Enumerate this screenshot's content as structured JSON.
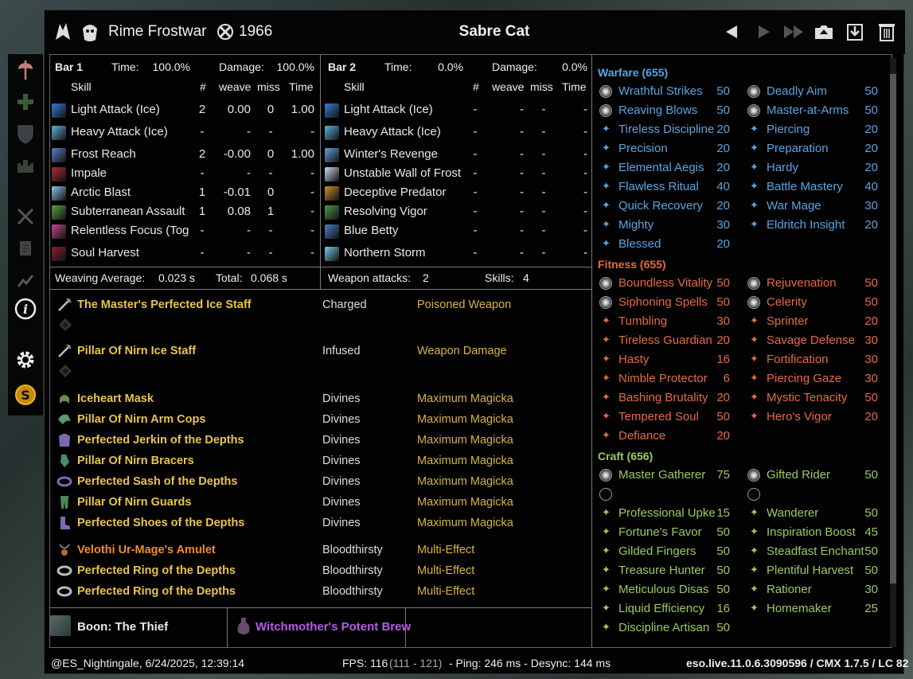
{
  "window": {
    "player_name": "Rime Frostwar",
    "champion_points": "1966",
    "title": "Sabre Cat"
  },
  "sidebar": {
    "icons": [
      "axe-icon",
      "heal-cross-icon",
      "shield-icon",
      "castle-icon",
      "crossed-swords-icon",
      "scroll-icon",
      "chart-icon",
      "info-icon",
      "gear-icon",
      "s-coin-icon"
    ]
  },
  "bar1": {
    "label": "Bar 1",
    "time_label": "Time:",
    "time": "100.0%",
    "damage_label": "Damage:",
    "damage": "100.0%",
    "col_skill": "Skill",
    "col_count": "#",
    "col_weave": "weave",
    "col_miss": "miss",
    "col_time": "Time",
    "rows": [
      {
        "skill": "Light Attack (Ice)",
        "count": "2",
        "weave": "0.00",
        "miss": "0",
        "time": "1.00",
        "color": "#3a7bd5"
      },
      {
        "skill": "Heavy Attack (Ice)",
        "count": "-",
        "weave": "-",
        "miss": "-",
        "time": "-",
        "color": "#5fb0e0"
      },
      {
        "skill": "Frost Reach",
        "count": "2",
        "weave": "-0.00",
        "miss": "0",
        "time": "1.00",
        "color": "#5b7fc4"
      },
      {
        "skill": "Impale",
        "count": "-",
        "weave": "-",
        "miss": "-",
        "time": "-",
        "color": "#b02a3a"
      },
      {
        "skill": "Arctic Blast",
        "count": "1",
        "weave": "-0.01",
        "miss": "0",
        "time": "-",
        "color": "#8fc0ea"
      },
      {
        "skill": "Subterranean Assault",
        "count": "1",
        "weave": "0.08",
        "miss": "1",
        "time": "-",
        "color": "#5aa040"
      },
      {
        "skill": "Relentless Focus (Tog",
        "count": "-",
        "weave": "-",
        "miss": "-",
        "time": "-",
        "color": "#c04a8a"
      },
      {
        "skill": "Soul Harvest",
        "count": "-",
        "weave": "-",
        "miss": "-",
        "time": "-",
        "color": "#8a2030"
      }
    ]
  },
  "bar2": {
    "label": "Bar 2",
    "time_label": "Time:",
    "time": "0.0%",
    "damage_label": "Damage:",
    "damage": "0.0%",
    "col_skill": "Skill",
    "col_count": "#",
    "col_weave": "weave",
    "col_miss": "miss",
    "col_time": "Time",
    "rows": [
      {
        "skill": "Light Attack (Ice)",
        "count": "-",
        "weave": "-",
        "miss": "-",
        "time": "-",
        "color": "#3a7bd5"
      },
      {
        "skill": "Heavy Attack (Ice)",
        "count": "-",
        "weave": "-",
        "miss": "-",
        "time": "-",
        "color": "#5fb0e0"
      },
      {
        "skill": "Winter's Revenge",
        "count": "-",
        "weave": "-",
        "miss": "-",
        "time": "-",
        "color": "#6aa0d8"
      },
      {
        "skill": "Unstable Wall of Frost",
        "count": "-",
        "weave": "-",
        "miss": "-",
        "time": "-",
        "color": "#c8d8f0"
      },
      {
        "skill": "Deceptive Predator",
        "count": "-",
        "weave": "-",
        "miss": "-",
        "time": "-",
        "color": "#c89030"
      },
      {
        "skill": "Resolving Vigor",
        "count": "-",
        "weave": "-",
        "miss": "-",
        "time": "-",
        "color": "#4a9a50"
      },
      {
        "skill": "Blue Betty",
        "count": "-",
        "weave": "-",
        "miss": "-",
        "time": "-",
        "color": "#4a80c0"
      },
      {
        "skill": "Northern Storm",
        "count": "-",
        "weave": "-",
        "miss": "-",
        "time": "-",
        "color": "#80c8e8"
      }
    ]
  },
  "stats": {
    "weaving_avg_label": "Weaving Average:",
    "weaving_avg": "0.023 s",
    "total_label": "Total:",
    "total": "0.068 s",
    "weapon_attacks_label": "Weapon attacks:",
    "weapon_attacks": "2",
    "skills_label": "Skills:",
    "skills": "4"
  },
  "equipment": [
    {
      "name": "The Master's Perfected Ice Staff",
      "trait": "Charged",
      "enchant": "Poisoned Weapon",
      "quality": "gold",
      "icon": "staff-icon"
    },
    {
      "name": "Pillar Of Nirn Ice Staff",
      "trait": "Infused",
      "enchant": "Weapon Damage",
      "quality": "gold",
      "icon": "staff-icon"
    },
    {
      "name": "Iceheart Mask",
      "trait": "Divines",
      "enchant": "Maximum Magicka",
      "quality": "gold",
      "icon": "helmet-icon"
    },
    {
      "name": "Pillar Of Nirn Arm Cops",
      "trait": "Divines",
      "enchant": "Maximum Magicka",
      "quality": "gold",
      "icon": "shoulder-icon"
    },
    {
      "name": "Perfected Jerkin of the Depths",
      "trait": "Divines",
      "enchant": "Maximum Magicka",
      "quality": "gold",
      "icon": "chest-icon"
    },
    {
      "name": "Pillar Of Nirn Bracers",
      "trait": "Divines",
      "enchant": "Maximum Magicka",
      "quality": "gold",
      "icon": "gloves-icon"
    },
    {
      "name": "Perfected Sash of the Depths",
      "trait": "Divines",
      "enchant": "Maximum Magicka",
      "quality": "gold",
      "icon": "belt-icon"
    },
    {
      "name": "Pillar Of Nirn Guards",
      "trait": "Divines",
      "enchant": "Maximum Magicka",
      "quality": "gold",
      "icon": "legs-icon"
    },
    {
      "name": "Perfected Shoes of the Depths",
      "trait": "Divines",
      "enchant": "Maximum Magicka",
      "quality": "gold",
      "icon": "boots-icon"
    },
    {
      "name": "Velothi Ur-Mage's Amulet",
      "trait": "Bloodthirsty",
      "enchant": "Multi-Effect",
      "quality": "orange",
      "icon": "amulet-icon"
    },
    {
      "name": "Perfected Ring of the Depths",
      "trait": "Bloodthirsty",
      "enchant": "Multi-Effect",
      "quality": "gold",
      "icon": "ring-icon"
    },
    {
      "name": "Perfected Ring of the Depths",
      "trait": "Bloodthirsty",
      "enchant": "Multi-Effect",
      "quality": "gold",
      "icon": "ring-icon"
    }
  ],
  "boon": "Boon: The Thief",
  "food": "Witchmother's Potent Brew",
  "cp": {
    "warfare": {
      "title": "Warfare (655)",
      "left": [
        {
          "name": "Wrathful Strikes",
          "val": "50",
          "slotted": true
        },
        {
          "name": "Reaving Blows",
          "val": "50",
          "slotted": true
        },
        {
          "name": "Tireless Discipline",
          "val": "20"
        },
        {
          "name": "Precision",
          "val": "20"
        },
        {
          "name": "Elemental Aegis",
          "val": "20"
        },
        {
          "name": "Flawless Ritual",
          "val": "40"
        },
        {
          "name": "Quick Recovery",
          "val": "20"
        },
        {
          "name": "Mighty",
          "val": "30"
        },
        {
          "name": "Blessed",
          "val": "20"
        }
      ],
      "right": [
        {
          "name": "Deadly Aim",
          "val": "50",
          "slotted": true
        },
        {
          "name": "Master-at-Arms",
          "val": "50",
          "slotted": true
        },
        {
          "name": "Piercing",
          "val": "20"
        },
        {
          "name": "Preparation",
          "val": "20"
        },
        {
          "name": "Hardy",
          "val": "20"
        },
        {
          "name": "Battle Mastery",
          "val": "40"
        },
        {
          "name": "War Mage",
          "val": "30"
        },
        {
          "name": "Eldritch Insight",
          "val": "20"
        }
      ]
    },
    "fitness": {
      "title": "Fitness (655)",
      "left": [
        {
          "name": "Boundless Vitality",
          "val": "50",
          "slotted": true
        },
        {
          "name": "Siphoning Spells",
          "val": "50",
          "slotted": true
        },
        {
          "name": "Tumbling",
          "val": "30"
        },
        {
          "name": "Tireless Guardian",
          "val": "20"
        },
        {
          "name": "Hasty",
          "val": "16"
        },
        {
          "name": "Nimble Protector",
          "val": "6"
        },
        {
          "name": "Bashing Brutality",
          "val": "20"
        },
        {
          "name": "Tempered Soul",
          "val": "50"
        },
        {
          "name": "Defiance",
          "val": "20"
        }
      ],
      "right": [
        {
          "name": "Rejuvenation",
          "val": "50",
          "slotted": true
        },
        {
          "name": "Celerity",
          "val": "50",
          "slotted": true
        },
        {
          "name": "Sprinter",
          "val": "20"
        },
        {
          "name": "Savage Defense",
          "val": "30"
        },
        {
          "name": "Fortification",
          "val": "30"
        },
        {
          "name": "Piercing Gaze",
          "val": "30"
        },
        {
          "name": "Mystic Tenacity",
          "val": "50"
        },
        {
          "name": "Hero's Vigor",
          "val": "20"
        }
      ]
    },
    "craft": {
      "title": "Craft (656)",
      "left": [
        {
          "name": "Master Gatherer",
          "val": "75",
          "slotted": true
        },
        {
          "name": "",
          "val": "",
          "slotted": true,
          "empty": true
        },
        {
          "name": "Professional Upke",
          "val": "15"
        },
        {
          "name": "Fortune's Favor",
          "val": "50"
        },
        {
          "name": "Gilded Fingers",
          "val": "50"
        },
        {
          "name": "Treasure Hunter",
          "val": "50"
        },
        {
          "name": "Meticulous Disas",
          "val": "50"
        },
        {
          "name": "Liquid Efficiency",
          "val": "16"
        },
        {
          "name": "Discipline Artisan",
          "val": "50"
        }
      ],
      "right": [
        {
          "name": "Gifted Rider",
          "val": "50",
          "slotted": true
        },
        {
          "name": "",
          "val": "",
          "slotted": true,
          "empty": true
        },
        {
          "name": "Wanderer",
          "val": "50"
        },
        {
          "name": "Inspiration Boost",
          "val": "45"
        },
        {
          "name": "Steadfast Enchant",
          "val": "50"
        },
        {
          "name": "Plentiful Harvest",
          "val": "50"
        },
        {
          "name": "Rationer",
          "val": "30"
        },
        {
          "name": "Homemaker",
          "val": "25"
        }
      ]
    }
  },
  "footer": {
    "author": "@ES_Nightingale, 6/24/2025, 12:39:14",
    "fps": "FPS: 116",
    "fps_range": "(111 - 121)",
    "ping": "- Ping: 246 ms - Desync: 144 ms",
    "version": "eso.live.11.0.6.3090596 / CMX 1.7.5 / LC 82"
  },
  "colors": {
    "gold": "#e9c44a",
    "orange": "#f08a2a",
    "purple": "#b55ae8",
    "warfare": "#5aa4e0",
    "fitness": "#e46a42",
    "craft": "#9ec860"
  }
}
